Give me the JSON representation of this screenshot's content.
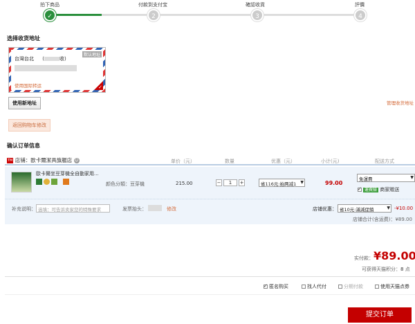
{
  "steps": [
    {
      "label": "拍下商品",
      "num": "✓"
    },
    {
      "label": "付款到支付宝",
      "num": "2"
    },
    {
      "label": "確認收貨",
      "num": "3"
    },
    {
      "label": "評價",
      "num": "4"
    }
  ],
  "address_section": {
    "title": "选择收货地址",
    "card": {
      "region": "台灣台北",
      "receiver_suffix": "收)",
      "receiver_prefix": "(",
      "default_tag": "默认地址",
      "intl_link": "使用国际转运"
    },
    "new_address_button": "使用新地址",
    "manage_link": "管理收货地址",
    "back_to_cart": "返回购物车修改"
  },
  "order_section": {
    "title": "确认订单信息",
    "headers": {
      "unit_price": "单价（元）",
      "quantity": "数量",
      "discount": "优惠（元）",
      "subtotal": "小计(元)",
      "shipping": "配送方式"
    },
    "shop": {
      "label": "店铺：",
      "name": "歐卡爾潔具旗艦店"
    },
    "item": {
      "title": "歐卡爾坐豆芽機全自動家用...",
      "variant_label": "颜色分類：",
      "variant_value": "豆芽機",
      "unit_price": "215.00",
      "quantity": "1",
      "discount_select": "省116元:拍两减1",
      "subtotal": "99.00",
      "shipping_select": "免運費",
      "shipping_tag": "運費險",
      "shipping_note": "商家贈送"
    },
    "remark": {
      "label": "补充说明：",
      "placeholder": "选填：可告诉卖家您的特殊要求",
      "invoice_label": "发票抬头：",
      "invoice_edit": "修改"
    },
    "shop_discount": {
      "label": "店铺优惠：",
      "select": "省10元:滿減促銷",
      "value": "-¥10.00",
      "total_label": "店铺合计(含运费)：",
      "total": "¥89.00"
    }
  },
  "summary": {
    "pay_label": "实付款：",
    "pay_amount": "¥89.00",
    "points_label": "可获得天猫积分：",
    "points": "8",
    "points_unit": "点"
  },
  "options": [
    {
      "label": "匿名购买",
      "checked": true
    },
    {
      "label": "找人代付",
      "checked": false
    },
    {
      "label": "分期付款",
      "checked": false
    },
    {
      "label": "使用天猫点券",
      "checked": false
    }
  ],
  "submit_label": "提交订单"
}
